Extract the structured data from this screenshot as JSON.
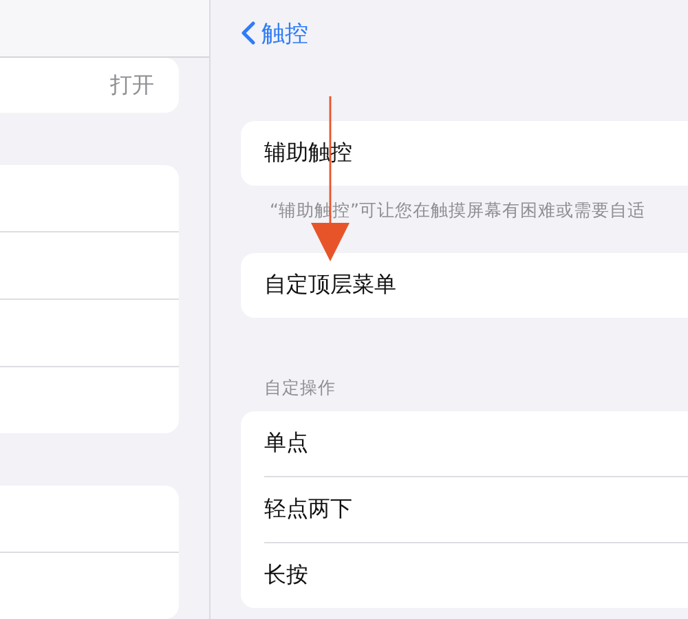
{
  "sidebar": {
    "top_row_value": "打开"
  },
  "nav": {
    "back": "触控"
  },
  "main_item": {
    "label": "辅助触控",
    "footer": "“辅助触控”可让您在触摸屏幕有困难或需要自适"
  },
  "menu_item": {
    "label": "自定顶层菜单"
  },
  "custom_actions": {
    "header": "自定操作",
    "items": [
      {
        "label": "单点"
      },
      {
        "label": "轻点两下"
      },
      {
        "label": "长按"
      }
    ]
  }
}
